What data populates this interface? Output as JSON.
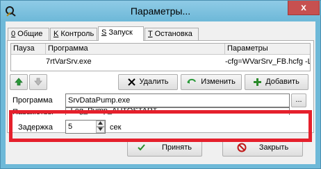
{
  "window": {
    "title": "Параметры...",
    "close_glyph": "x"
  },
  "tabs": [
    {
      "hotkey": "0",
      "label": " Общие"
    },
    {
      "hotkey": "K",
      "label": " Контроль"
    },
    {
      "hotkey": "S",
      "label": " Запуск"
    },
    {
      "hotkey": "T",
      "label": " Остановка"
    }
  ],
  "grid": {
    "headers": [
      "Пауза",
      "Программа",
      "Параметры"
    ],
    "rows": [
      {
        "pause": "",
        "program": "7rtVarSrv.exe",
        "params": "-cfg=WVarSrv_FB.hcfg -LO"
      }
    ]
  },
  "buttons": {
    "delete": "Удалить",
    "edit": "Изменить",
    "add": "Добавить",
    "browse": "...",
    "accept": "Принять",
    "close": "Закрыть"
  },
  "form": {
    "program_label": "Программа",
    "program_value": "SrvDataPump.exe",
    "params_label": "Параметры",
    "params_value": "-Log_Pump_AUTOSTART",
    "delay_label": "Задержка",
    "delay_value": "5",
    "delay_unit": "сек"
  },
  "colors": {
    "highlight": "#e5202c",
    "titlebar": "#6eb9d8",
    "close_button": "#c75050"
  }
}
